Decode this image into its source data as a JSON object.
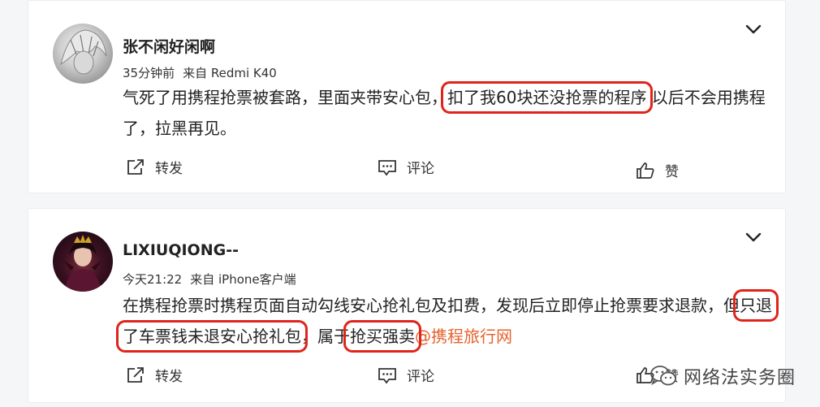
{
  "posts": [
    {
      "username": "张不闲好闲啊",
      "time": "35分钟前",
      "source": "来自 Redmi K40",
      "content": {
        "pre": "气死了用携程抢票被套路，里面夹带安心包，",
        "highlight1": "扣了我60块还没抢票的程序",
        "post": " 以后不会用携程了，拉黑再见。"
      },
      "actions": {
        "repost": "转发",
        "comment": "评论",
        "like": "赞"
      }
    },
    {
      "username": "LIXIUQIONG--",
      "time": "今天21:22",
      "source": "来自 iPhone客户端",
      "content": {
        "pre": "在携程抢票时携程页面自动勾线安心抢礼包及扣费，发现后立即停止抢票要求退款，但",
        "highlight1": "只退了车票钱未退安心抢礼包",
        "mid": "，属于",
        "highlight2": "抢买强卖",
        "mention": "@携程旅行网"
      },
      "actions": {
        "repost": "转发",
        "comment": "评论",
        "like": "赞"
      }
    }
  ],
  "watermark": {
    "text": "网络法实务圈"
  },
  "colors": {
    "highlight": "#e0241b",
    "mention": "#e6622d"
  }
}
